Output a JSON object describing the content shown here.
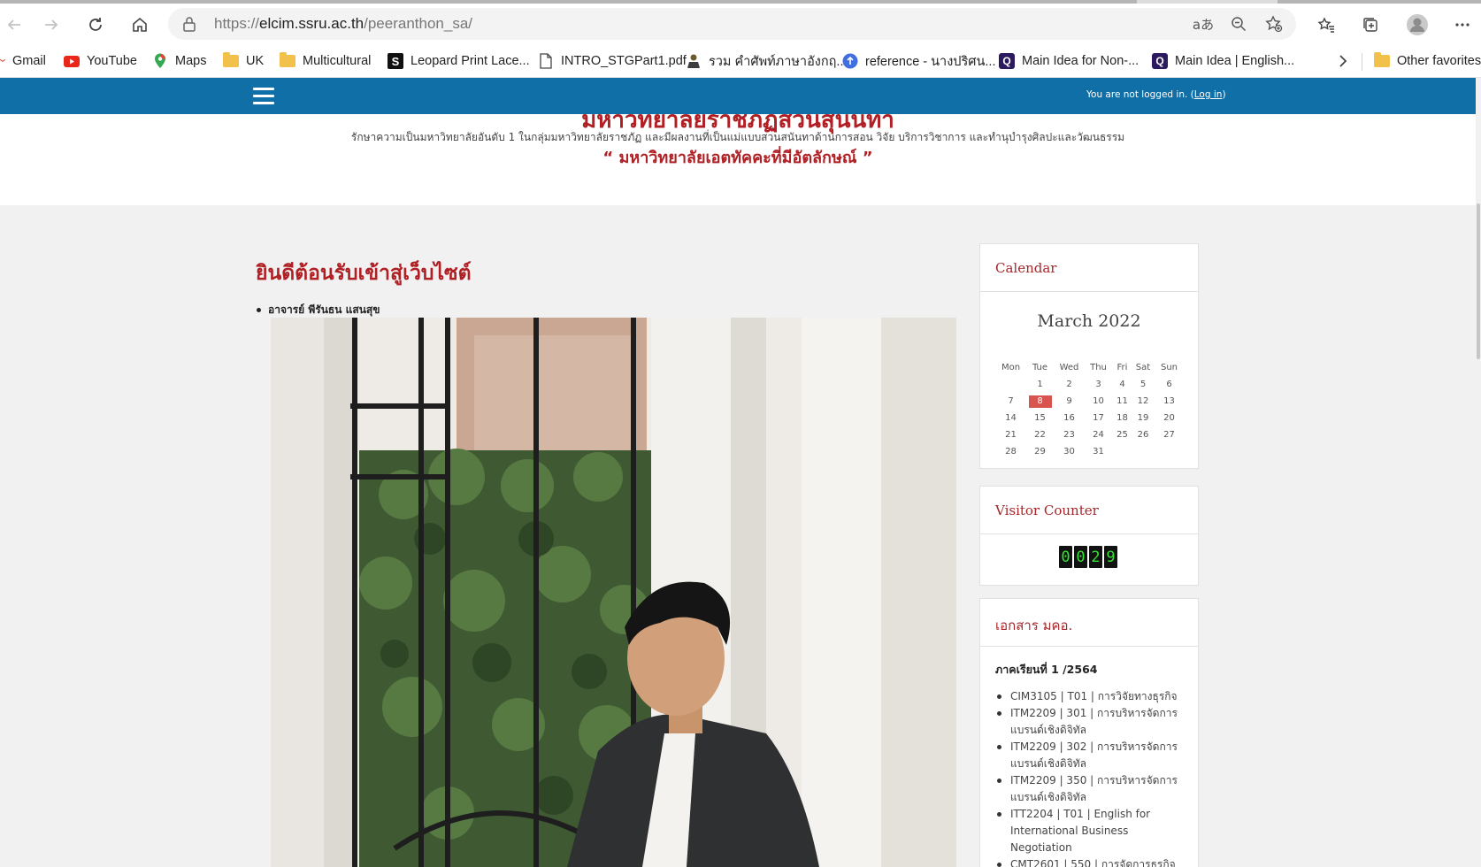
{
  "browser": {
    "url_host": "elcim.ssru.ac.th",
    "url_prefix": "https://",
    "url_path": "/peeranthon_sa/",
    "read_aloud_label": "aあ"
  },
  "bookmarks": [
    {
      "label": "Gmail",
      "icon": "gmail-icon"
    },
    {
      "label": "YouTube",
      "icon": "youtube-icon"
    },
    {
      "label": "Maps",
      "icon": "maps-icon"
    },
    {
      "label": "UK",
      "icon": "folder-icon"
    },
    {
      "label": "Multicultural",
      "icon": "folder-icon"
    },
    {
      "label": "Leopard Print Lace...",
      "icon": "s-icon"
    },
    {
      "label": "INTRO_STGPart1.pdf",
      "icon": "document-icon"
    },
    {
      "label": "รวม คำศัพท์ภาษาอังกฤ...",
      "icon": "person-icon"
    },
    {
      "label": "reference - นางปริศน...",
      "icon": "blue-circle-icon"
    },
    {
      "label": "Main Idea for Non-...",
      "icon": "q-icon"
    },
    {
      "label": "Main Idea | English...",
      "icon": "q-icon"
    }
  ],
  "other_favorites": "Other favorites",
  "site": {
    "login_text": "You are not logged in. (",
    "login_link": "Log in",
    "login_close": ")",
    "university_name": "มหาวิทยาลัยราชภัฏสวนสุนันทา",
    "tagline": "รักษาความเป็นมหาวิทยาลัยอันดับ 1 ในกลุ่มมหาวิทยาลัยราชภัฏ และมีผลงานที่เป็นแม่แบบสวนสนันทาด้านการสอน วิจัย บริการวิชาการ และทำนุบำรุงศิลปะและวัฒนธรรม",
    "motto": "“ มหาวิทยาลัยเอตทัคคะที่มีอัตลักษณ์ ”"
  },
  "main": {
    "welcome": "ยินดีต้อนรับเข้าสู่เว็บไซต์",
    "teacher": "อาจารย์ พีรันธน แสนสุข"
  },
  "sidebar": {
    "calendar": {
      "title": "Calendar",
      "month": "March 2022",
      "weekdays": [
        "Mon",
        "Tue",
        "Wed",
        "Thu",
        "Fri",
        "Sat",
        "Sun"
      ],
      "weeks": [
        [
          "",
          "1",
          "2",
          "3",
          "4",
          "5",
          "6"
        ],
        [
          "7",
          "8",
          "9",
          "10",
          "11",
          "12",
          "13"
        ],
        [
          "14",
          "15",
          "16",
          "17",
          "18",
          "19",
          "20"
        ],
        [
          "21",
          "22",
          "23",
          "24",
          "25",
          "26",
          "27"
        ],
        [
          "28",
          "29",
          "30",
          "31",
          "",
          "",
          ""
        ]
      ],
      "today": "8",
      "today_color": "#d9534f"
    },
    "visitor": {
      "title": "Visitor Counter",
      "digits": [
        "0",
        "0",
        "2",
        "9"
      ]
    },
    "docs": {
      "title": "เอกสาร มคอ.",
      "term": "ภาคเรียนที่ 1 /2564",
      "items": [
        "CIM3105 | T01 | การวิจัยทางธุรกิจ",
        "ITM2209 | 301 | การบริหารจัดการแบรนด์เชิงดิจิทัล",
        "ITM2209 | 302 | การบริหารจัดการแบรนด์เชิงดิจิทัล",
        "ITM2209 | 350 | การบริหารจัดการแบรนด์เชิงดิจิทัล",
        "ITT2204 | T01 | English for International Business Negotiation",
        "CMT2601 | 550 | การจัดการธุรกิจ"
      ]
    }
  },
  "colors": {
    "nav_blue": "#0f6fa6",
    "accent_red": "#b01f24",
    "heading_red": "#a6272b"
  }
}
